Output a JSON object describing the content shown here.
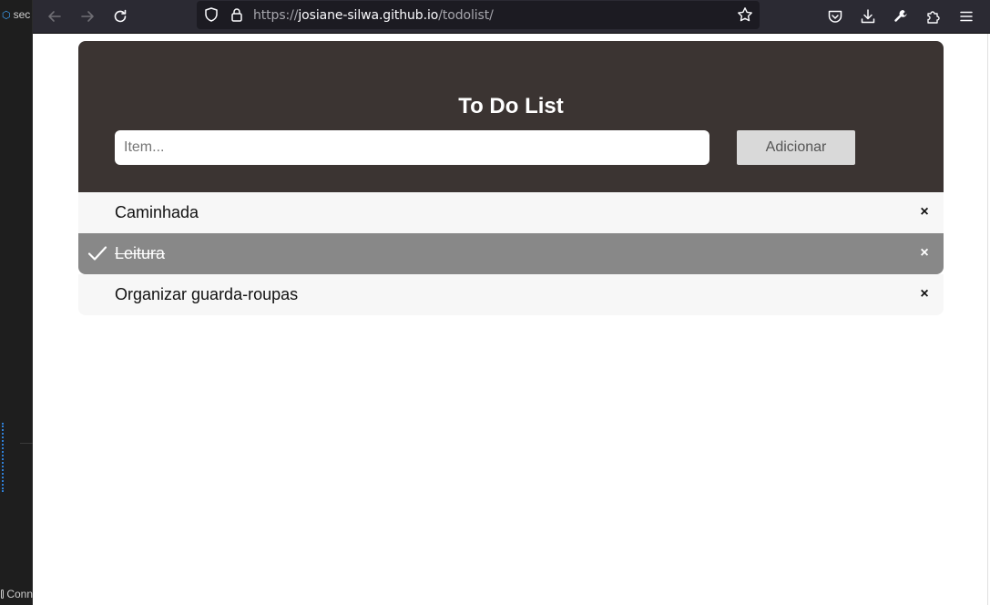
{
  "background_window": {
    "top_tab_label": "sec",
    "bottom_tab_label": "Conn"
  },
  "browser": {
    "url_prefix": "https://",
    "url_host": "josiane-silwa.github.io",
    "url_path": "/todolist/"
  },
  "app": {
    "title": "To Do List",
    "input": {
      "value": "",
      "placeholder": "Item..."
    },
    "add_button_label": "Adicionar",
    "items": [
      {
        "label": "Caminhada",
        "checked": false,
        "close_glyph": "×"
      },
      {
        "label": "Leitura",
        "checked": true,
        "close_glyph": "×"
      },
      {
        "label": "Organizar guarda-roupas",
        "checked": false,
        "close_glyph": "×"
      }
    ]
  },
  "colors": {
    "header_bg": "#3b3432",
    "checked_bg": "#888888",
    "item_bg": "#f7f7f7",
    "toolbar_bg": "#2b2a33"
  }
}
